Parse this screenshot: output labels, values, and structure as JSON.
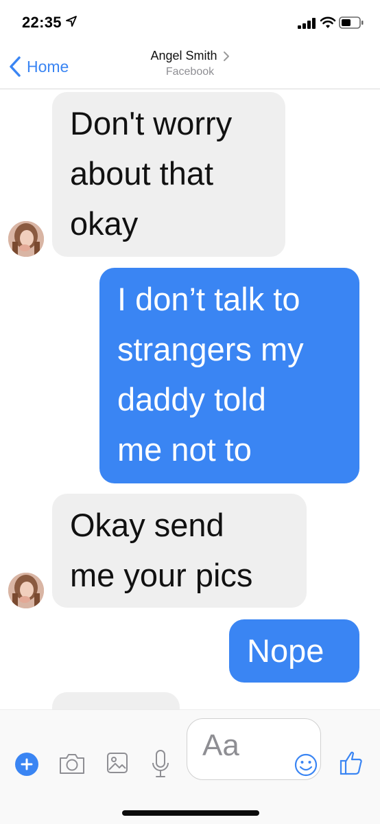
{
  "status_bar": {
    "time": "22:35",
    "icons": [
      "location-arrow-icon",
      "cellular-signal-icon",
      "wifi-icon",
      "battery-icon"
    ]
  },
  "header": {
    "back_label": "Home",
    "contact_name": "Angel Smith",
    "contact_subtitle": "Facebook"
  },
  "messages": [
    {
      "direction": "incoming",
      "text": "Don't worry\nabout that\nokay"
    },
    {
      "direction": "outgoing",
      "text": "I don’t talk to\nstrangers my\ndaddy told\nme not to"
    },
    {
      "direction": "incoming",
      "text": "Okay send\nme your pics"
    },
    {
      "direction": "outgoing",
      "text": "Nope"
    }
  ],
  "composer": {
    "placeholder": "Aa",
    "icons": [
      "plus-icon",
      "camera-icon",
      "image-icon",
      "microphone-icon",
      "emoji-icon",
      "thumbs-up-icon"
    ]
  },
  "colors": {
    "accent": "#3a85f3",
    "incoming_bubble": "#efefef",
    "outgoing_text": "#ffffff"
  }
}
